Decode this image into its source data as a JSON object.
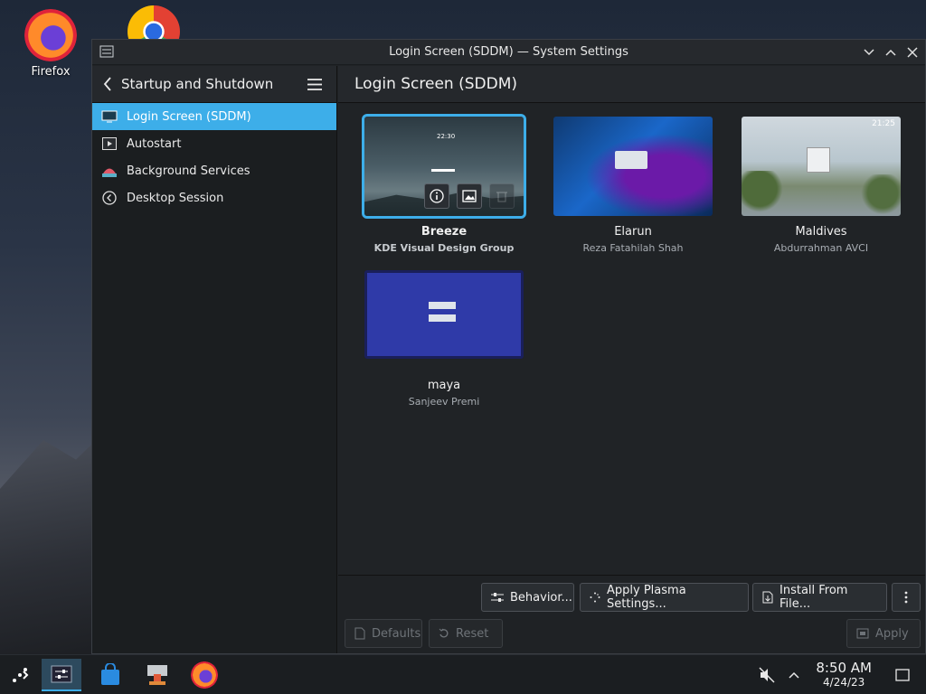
{
  "desktop": {
    "icons": [
      {
        "label": "Firefox"
      },
      {
        "label": ""
      }
    ]
  },
  "window": {
    "title": "Login Screen (SDDM) — System Settings"
  },
  "sidebar": {
    "header": "Startup and Shutdown",
    "items": [
      {
        "label": "Login Screen (SDDM)",
        "icon": "monitor-icon",
        "active": true
      },
      {
        "label": "Autostart",
        "icon": "play-icon"
      },
      {
        "label": "Background Services",
        "icon": "services-icon"
      },
      {
        "label": "Desktop Session",
        "icon": "session-icon"
      }
    ]
  },
  "main": {
    "title": "Login Screen (SDDM)",
    "themes": [
      {
        "name": "Breeze",
        "author": "KDE Visual Design Group",
        "selected": true,
        "clock": "22:30"
      },
      {
        "name": "Elarun",
        "author": "Reza Fatahilah Shah"
      },
      {
        "name": "Maldives",
        "author": "Abdurrahman AVCI",
        "clock": "21:25"
      },
      {
        "name": "maya",
        "author": "Sanjeev Premi"
      }
    ]
  },
  "footer": {
    "behavior": "Behavior...",
    "apply_plasma": "Apply Plasma Settings...",
    "install": "Install From File...",
    "defaults": "Defaults",
    "reset": "Reset",
    "apply": "Apply"
  },
  "taskbar": {
    "time": "8:50 AM",
    "date": "4/24/23"
  },
  "colors": {
    "accent": "#3daee9",
    "window_bg": "#202326"
  }
}
